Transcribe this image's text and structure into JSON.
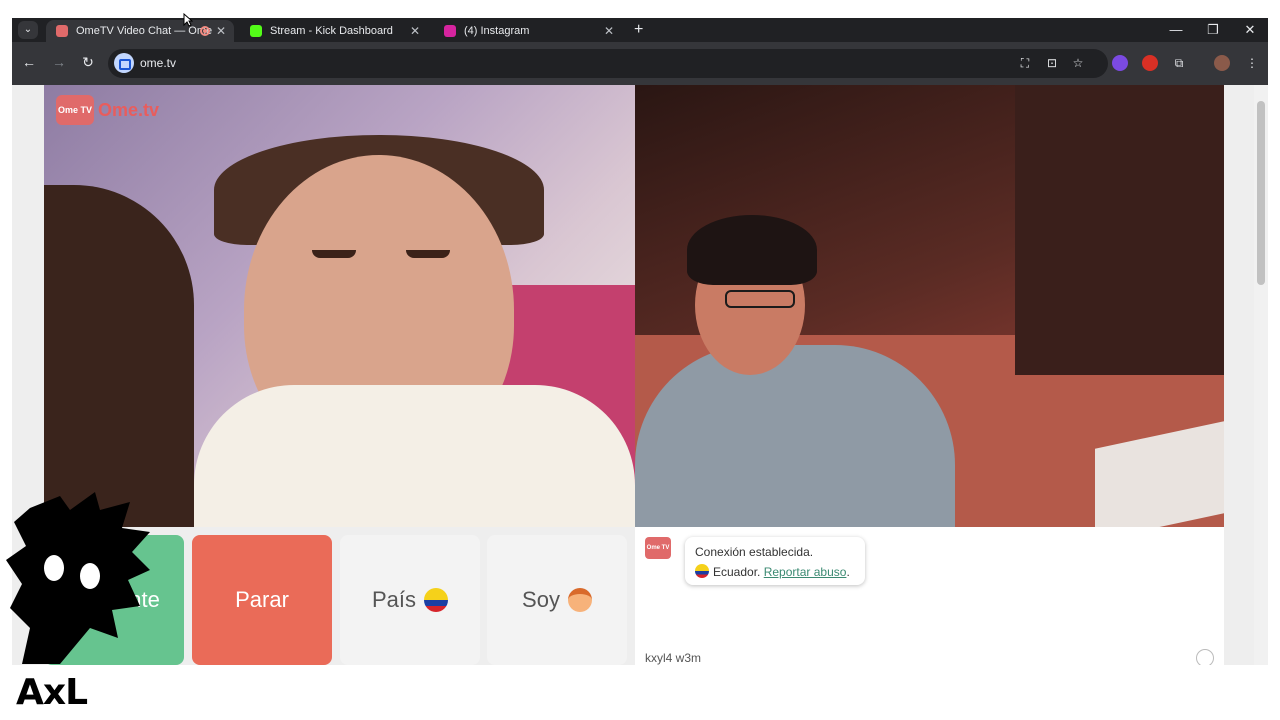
{
  "browser": {
    "tabs": [
      {
        "title": "OmeTV Video Chat — Ome",
        "active": true,
        "favicon_color": "#e06a6a"
      },
      {
        "title": "Stream - Kick Dashboard",
        "active": false,
        "favicon_color": "#53fc18"
      },
      {
        "title": "(4) Instagram",
        "active": false,
        "favicon_color": "#d6249f"
      }
    ],
    "url": "ome.tv"
  },
  "site": {
    "logo_badge": "Ome TV",
    "logo_text": "Ome.tv"
  },
  "controls": {
    "next_label": "Siguiente",
    "stop_label": "Parar",
    "country_label": "País",
    "gender_label": "Soy"
  },
  "chat": {
    "avatar_label": "Ome TV",
    "message_line1": "Conexión establecida.",
    "country": "Ecuador.",
    "report_link": "Reportar abuso",
    "report_suffix": ".",
    "input_text": "kxyl4  w3m"
  },
  "overlay": {
    "brand_text": "AxL"
  },
  "colors": {
    "next_button": "#66c48f",
    "stop_button": "#ea6b58",
    "accent_link": "#3b8a72"
  }
}
